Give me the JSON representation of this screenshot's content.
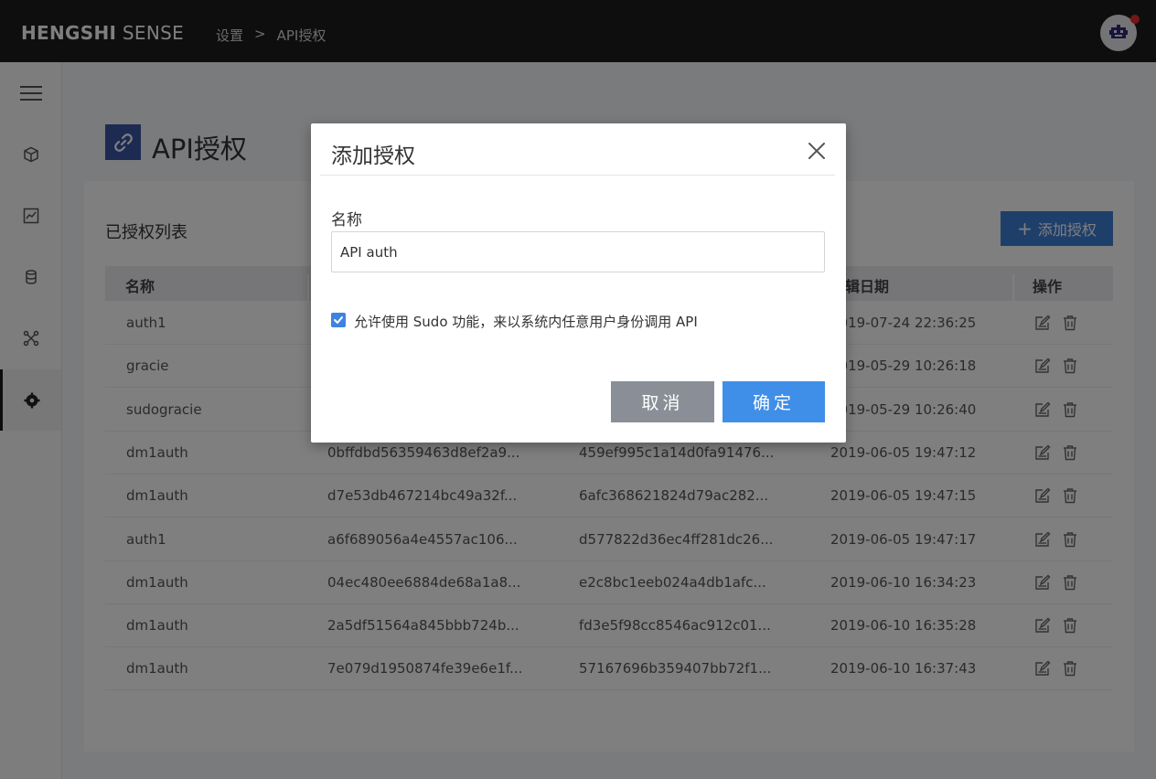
{
  "header": {
    "logo_bold": "HENGSHI",
    "logo_light": " SENSE",
    "breadcrumb": [
      "设置",
      ">",
      "API授权"
    ]
  },
  "sidebar": {
    "items": [
      {
        "icon": "hamburger-menu-icon"
      },
      {
        "icon": "cube-icon"
      },
      {
        "icon": "chart-icon"
      },
      {
        "icon": "database-icon"
      },
      {
        "icon": "network-icon"
      },
      {
        "icon": "gear-icon",
        "active": true
      }
    ]
  },
  "page": {
    "title": "API授权",
    "list_title": "已授权列表",
    "add_button": "添加授权",
    "add_icon": "+"
  },
  "table": {
    "headers": [
      "名称",
      "",
      "",
      "编辑日期",
      "操作"
    ],
    "rows": [
      {
        "name": "auth1",
        "key": "",
        "secret": "",
        "date": "2019-07-24 22:36:25"
      },
      {
        "name": "gracie",
        "key": "",
        "secret": "",
        "date": "2019-05-29 10:26:18"
      },
      {
        "name": "sudogracie",
        "key": "",
        "secret": "",
        "date": "2019-05-29 10:26:40"
      },
      {
        "name": "dm1auth",
        "key": "0bffdbd56359463d8ef2a9...",
        "secret": "459ef995c1a14d0fa91476...",
        "date": "2019-06-05 19:47:12"
      },
      {
        "name": "dm1auth",
        "key": "d7e53db467214bc49a32f...",
        "secret": "6afc368621824d79ac282...",
        "date": "2019-06-05 19:47:15"
      },
      {
        "name": "auth1",
        "key": "a6f689056a4e4557ac106...",
        "secret": "d577822d36ec4ff281dc26...",
        "date": "2019-06-05 19:47:17"
      },
      {
        "name": "dm1auth",
        "key": "04ec480ee6884de68a1a8...",
        "secret": "e2c8bc1eeb024a4db1afc...",
        "date": "2019-06-10 16:34:23"
      },
      {
        "name": "dm1auth",
        "key": "2a5df51564a845bbb724b...",
        "secret": "fd3e5f98cc8546ac912c01...",
        "date": "2019-06-10 16:35:28"
      },
      {
        "name": "dm1auth",
        "key": "7e079d1950874fe39e6e1f...",
        "secret": "57167696b359407bb72f1...",
        "date": "2019-06-10 16:37:43"
      }
    ]
  },
  "modal": {
    "title": "添加授权",
    "name_label": "名称",
    "name_value": "API auth",
    "sudo_checked": true,
    "sudo_label": "允许使用 Sudo 功能，来以系统内任意用户身份调用 API",
    "cancel": "取消",
    "confirm": "确定"
  },
  "colors": {
    "topbar": "#1c1c1c",
    "accent": "#3f8ee8",
    "page_icon": "#3b57a6"
  }
}
